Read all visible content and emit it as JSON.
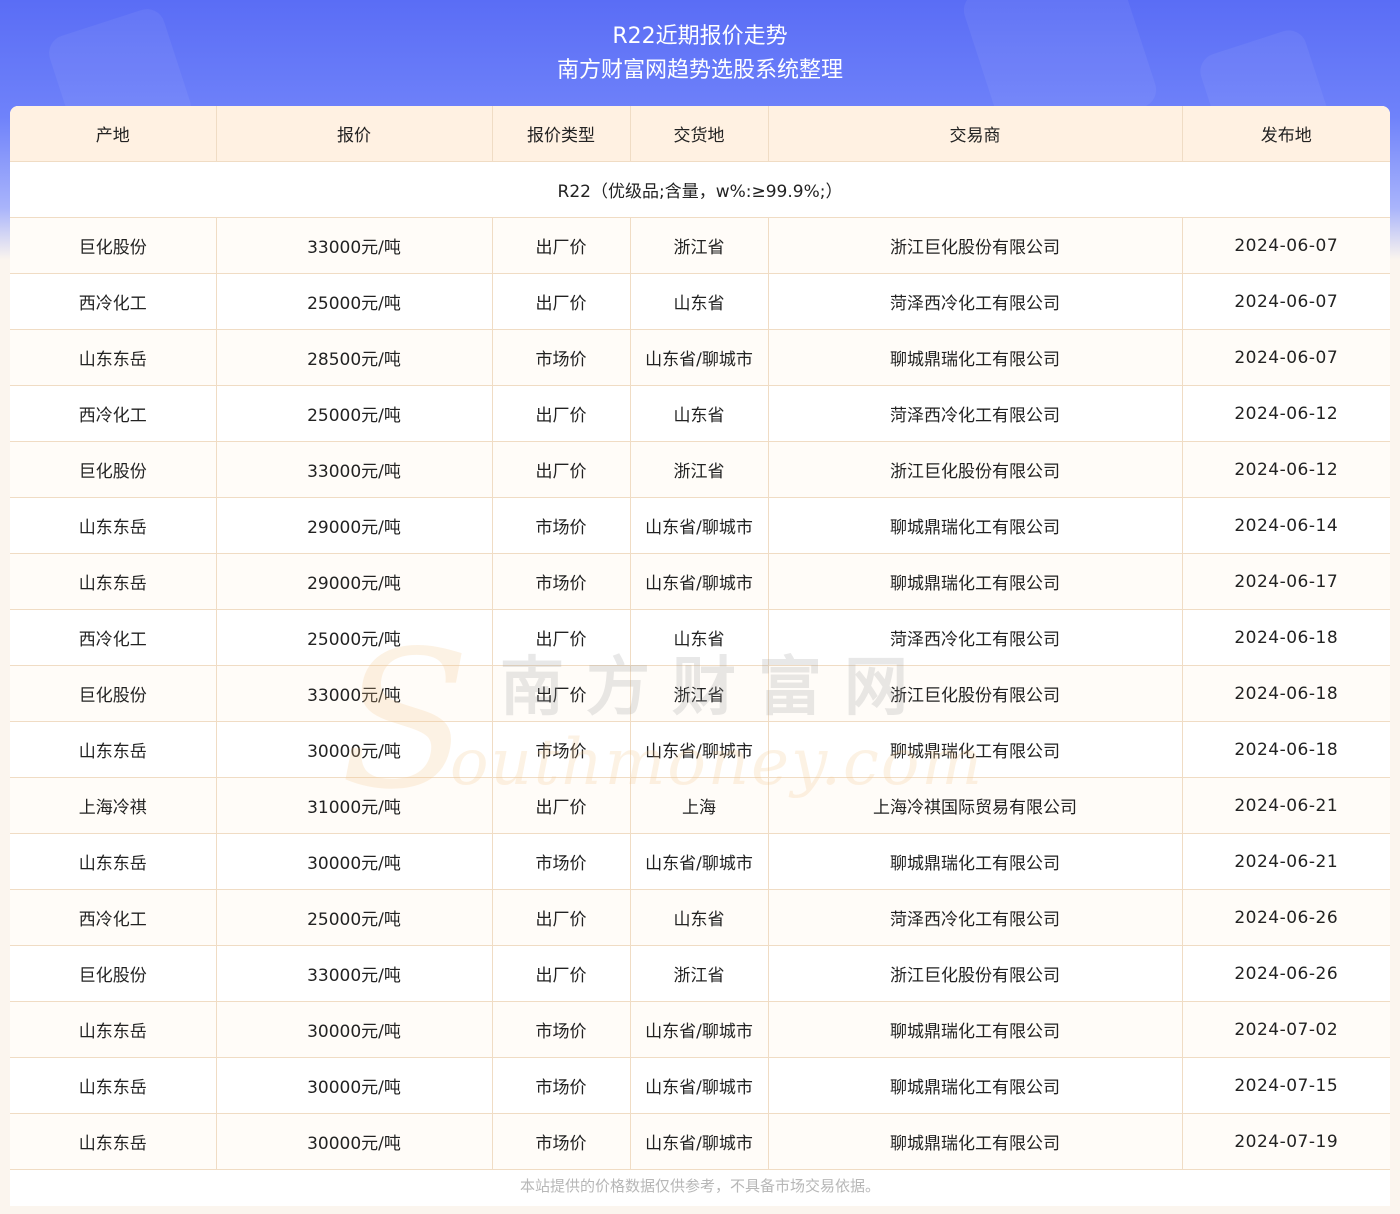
{
  "header": {
    "title": "R22近期报价走势",
    "subtitle": "南方财富网趋势选股系统整理"
  },
  "table": {
    "columns": [
      "产地",
      "报价",
      "报价类型",
      "交货地",
      "交易商",
      "发布地"
    ],
    "product_row": "R22（优级品;含量，w%:≥99.9%;）",
    "rows": [
      [
        "巨化股份",
        "33000元/吨",
        "出厂价",
        "浙江省",
        "浙江巨化股份有限公司",
        "2024-06-07"
      ],
      [
        "西冷化工",
        "25000元/吨",
        "出厂价",
        "山东省",
        "菏泽西冷化工有限公司",
        "2024-06-07"
      ],
      [
        "山东东岳",
        "28500元/吨",
        "市场价",
        "山东省/聊城市",
        "聊城鼎瑞化工有限公司",
        "2024-06-07"
      ],
      [
        "西冷化工",
        "25000元/吨",
        "出厂价",
        "山东省",
        "菏泽西冷化工有限公司",
        "2024-06-12"
      ],
      [
        "巨化股份",
        "33000元/吨",
        "出厂价",
        "浙江省",
        "浙江巨化股份有限公司",
        "2024-06-12"
      ],
      [
        "山东东岳",
        "29000元/吨",
        "市场价",
        "山东省/聊城市",
        "聊城鼎瑞化工有限公司",
        "2024-06-14"
      ],
      [
        "山东东岳",
        "29000元/吨",
        "市场价",
        "山东省/聊城市",
        "聊城鼎瑞化工有限公司",
        "2024-06-17"
      ],
      [
        "西冷化工",
        "25000元/吨",
        "出厂价",
        "山东省",
        "菏泽西冷化工有限公司",
        "2024-06-18"
      ],
      [
        "巨化股份",
        "33000元/吨",
        "出厂价",
        "浙江省",
        "浙江巨化股份有限公司",
        "2024-06-18"
      ],
      [
        "山东东岳",
        "30000元/吨",
        "市场价",
        "山东省/聊城市",
        "聊城鼎瑞化工有限公司",
        "2024-06-18"
      ],
      [
        "上海冷祺",
        "31000元/吨",
        "出厂价",
        "上海",
        "上海冷祺国际贸易有限公司",
        "2024-06-21"
      ],
      [
        "山东东岳",
        "30000元/吨",
        "市场价",
        "山东省/聊城市",
        "聊城鼎瑞化工有限公司",
        "2024-06-21"
      ],
      [
        "西冷化工",
        "25000元/吨",
        "出厂价",
        "山东省",
        "菏泽西冷化工有限公司",
        "2024-06-26"
      ],
      [
        "巨化股份",
        "33000元/吨",
        "出厂价",
        "浙江省",
        "浙江巨化股份有限公司",
        "2024-06-26"
      ],
      [
        "山东东岳",
        "30000元/吨",
        "市场价",
        "山东省/聊城市",
        "聊城鼎瑞化工有限公司",
        "2024-07-02"
      ],
      [
        "山东东岳",
        "30000元/吨",
        "市场价",
        "山东省/聊城市",
        "聊城鼎瑞化工有限公司",
        "2024-07-15"
      ],
      [
        "山东东岳",
        "30000元/吨",
        "市场价",
        "山东省/聊城市",
        "聊城鼎瑞化工有限公司",
        "2024-07-19"
      ]
    ]
  },
  "footer": {
    "disclaimer": "本站提供的价格数据仅供参考，不具备市场交易依据。"
  },
  "watermark": {
    "letter": "S",
    "cn": "南方财富网",
    "en": "outhmoney.com"
  },
  "colors": {
    "header_gradient_top": "#5a6df5",
    "header_row_bg": "#fff1e2",
    "border": "#f0dcc4",
    "watermark_orange": "#f6c68a"
  }
}
